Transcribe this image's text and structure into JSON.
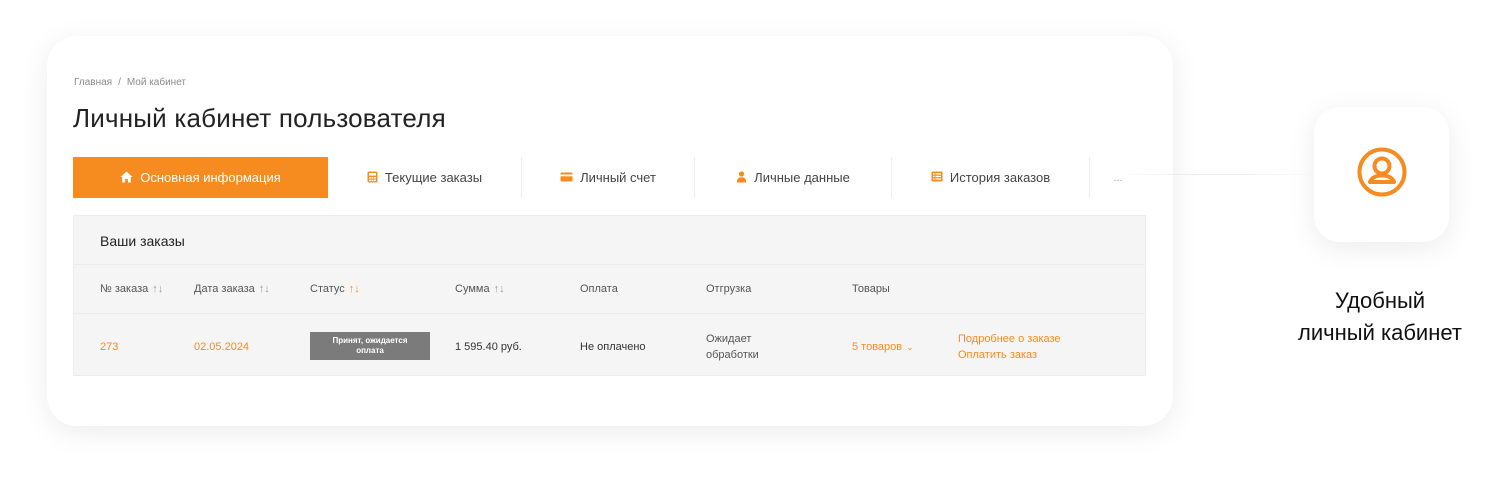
{
  "breadcrumb": {
    "home": "Главная",
    "separator": "/",
    "current": "Мой кабинет"
  },
  "page_title": "Личный кабинет пользователя",
  "tabs": [
    {
      "label": "Основная информация",
      "icon": "home-icon",
      "active": true
    },
    {
      "label": "Текущие заказы",
      "icon": "calculator-icon",
      "active": false
    },
    {
      "label": "Личный счет",
      "icon": "credit-card-icon",
      "active": false
    },
    {
      "label": "Личные данные",
      "icon": "user-icon",
      "active": false
    },
    {
      "label": "История заказов",
      "icon": "list-icon",
      "active": false
    },
    {
      "label": "...",
      "icon": "",
      "active": false
    }
  ],
  "orders": {
    "title": "Ваши заказы",
    "columns": [
      "№ заказа",
      "Дата заказа",
      "Статус",
      "Сумма",
      "Оплата",
      "Отгрузка",
      "Товары"
    ],
    "sort_icon": "↑↓",
    "rows": [
      {
        "number": "273",
        "date": "02.05.2024",
        "status_line1": "Принят, ожидается",
        "status_line2": "оплата",
        "sum": "1 595.40 руб.",
        "payment": "Не оплачено",
        "shipment_line1": "Ожидает",
        "shipment_line2": "обработки",
        "goods": "5 товаров",
        "link_details": "Подробнее о заказе",
        "link_pay": "Оплатить заказ"
      }
    ]
  },
  "feature": {
    "icon": "user-circle-icon",
    "label_line1": "Удобный",
    "label_line2": "личный кабинет"
  },
  "colors": {
    "accent": "#f68b1f",
    "status_badge": "#7b7b7b",
    "panel_bg": "#f5f5f5"
  }
}
